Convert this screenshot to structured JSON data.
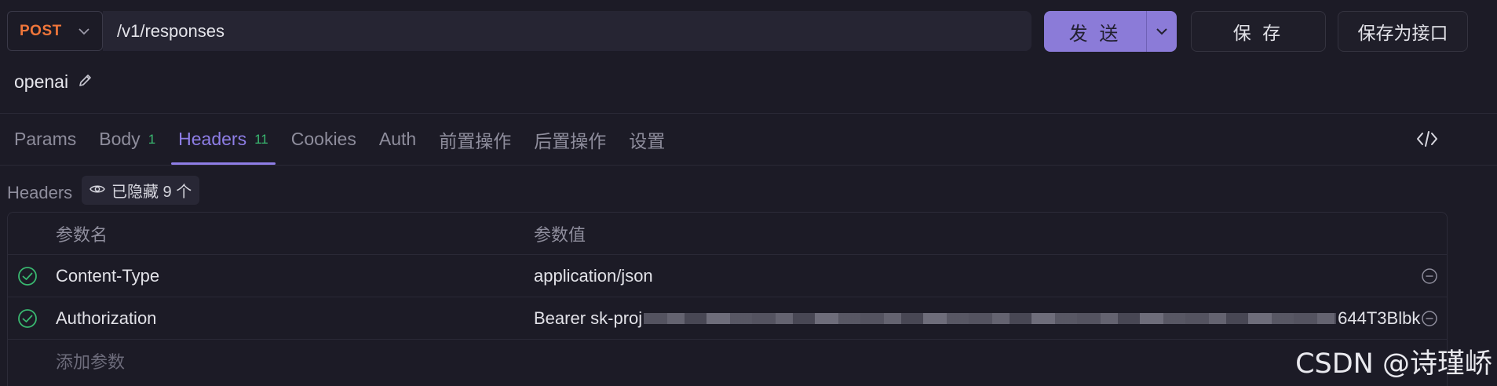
{
  "request": {
    "method": "POST",
    "url": "/v1/responses",
    "name": "openai"
  },
  "actions": {
    "send_label": "发 送",
    "save_label": "保 存",
    "save_as_api_label": "保存为接口"
  },
  "tabs": [
    {
      "label": "Params",
      "badge": ""
    },
    {
      "label": "Body",
      "badge": "1"
    },
    {
      "label": "Headers",
      "badge": "11",
      "active": true
    },
    {
      "label": "Cookies",
      "badge": ""
    },
    {
      "label": "Auth",
      "badge": ""
    },
    {
      "label": "前置操作",
      "badge": ""
    },
    {
      "label": "后置操作",
      "badge": ""
    },
    {
      "label": "设置",
      "badge": ""
    }
  ],
  "headers_section": {
    "label": "Headers",
    "hidden_chip": "已隐藏 9 个"
  },
  "table": {
    "col_name": "参数名",
    "col_value": "参数值",
    "rows": [
      {
        "name": "Content-Type",
        "value": "application/json",
        "enabled": true
      },
      {
        "name": "Authorization",
        "value_prefix": "Bearer sk-proj",
        "value_suffix": "644T3Blbk",
        "enabled": true
      }
    ],
    "add_placeholder": "添加参数"
  },
  "watermark": "CSDN @诗瑾峤",
  "colors": {
    "accent": "#8e7ee6",
    "method": "#f0763a",
    "send_bg": "#8b7bd8",
    "check": "#39b870",
    "background": "#1c1b26"
  },
  "icons": [
    "chevron-down-icon",
    "edit-pencil-icon",
    "code-icon",
    "eye-icon",
    "check-circle-icon",
    "remove-circle-icon"
  ]
}
